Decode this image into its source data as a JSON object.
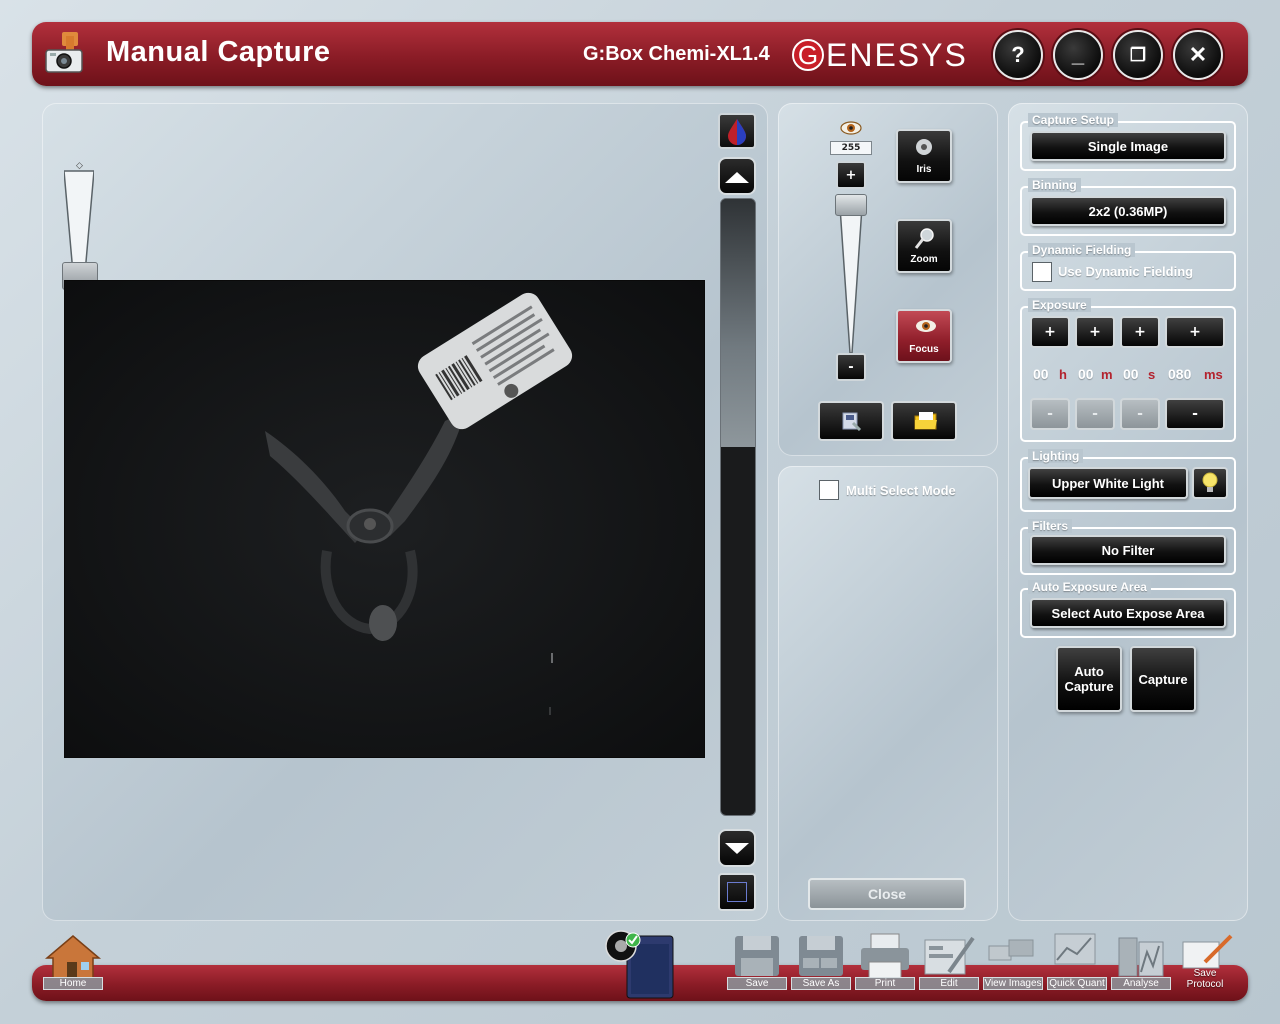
{
  "window": {
    "title": "Manual Capture",
    "model": "G:Box Chemi-XL1.4",
    "brand_g": "G",
    "brand_rest": "ENESYS",
    "buttons": {
      "help": "?",
      "minimize": "_",
      "restore": "❐",
      "close": "✕"
    }
  },
  "camera": {
    "iris_value": "255",
    "plus_label": "+",
    "minus_label": "-",
    "iris_label": "Iris",
    "zoom_label": "Zoom",
    "focus_label": "Focus"
  },
  "multi_select": {
    "label": "Multi Select Mode",
    "close_label": "Close"
  },
  "settings": {
    "capture_setup": {
      "label": "Capture Setup",
      "value": "Single Image"
    },
    "binning": {
      "label": "Binning",
      "value": "2x2 (0.36MP)"
    },
    "dynamic_fielding": {
      "label": "Dynamic Fielding",
      "option": "Use Dynamic Fielding"
    },
    "exposure": {
      "label": "Exposure",
      "plus": "+",
      "minus": "-",
      "hours": "00",
      "hours_unit": "h",
      "minutes": "00",
      "minutes_unit": "m",
      "seconds": "00",
      "seconds_unit": "s",
      "milliseconds": "080",
      "milliseconds_unit": "ms"
    },
    "lighting": {
      "label": "Lighting",
      "value": "Upper White Light"
    },
    "filters": {
      "label": "Filters",
      "value": "No Filter"
    },
    "auto_exposure_area": {
      "label": "Auto Exposure Area",
      "value": "Select Auto Expose Area"
    },
    "auto_capture_label": "Auto Capture",
    "capture_label": "Capture"
  },
  "dock": {
    "home": "Home",
    "save": "Save",
    "save_as": "Save As",
    "print": "Print",
    "edit": "Edit",
    "view_images": "View Images",
    "quick_quant": "Quick Quant",
    "analyse": "Analyse",
    "save_protocol": "Save Protocol"
  },
  "colors": {
    "accent_red": "#8a1c26",
    "unit_red": "#b3232e",
    "panel": "#c2ced6"
  }
}
